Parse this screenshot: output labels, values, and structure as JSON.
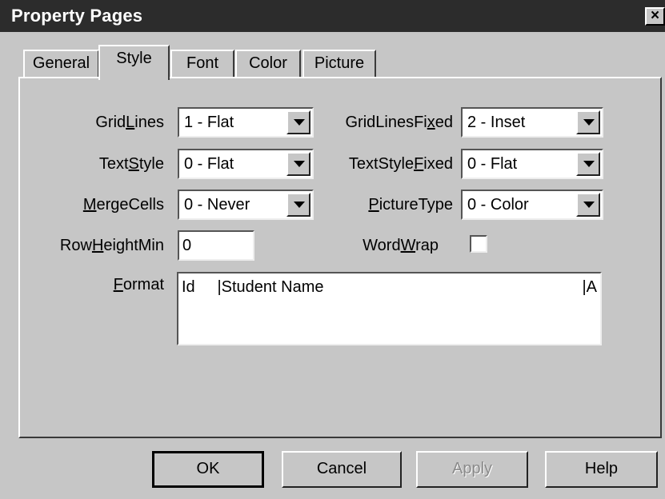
{
  "window": {
    "title": "Property Pages",
    "close_glyph": "×"
  },
  "tabs": [
    {
      "label": "General",
      "active": false
    },
    {
      "label": "Style",
      "active": true
    },
    {
      "label": "Font",
      "active": false
    },
    {
      "label": "Color",
      "active": false
    },
    {
      "label": "Picture",
      "active": false
    }
  ],
  "fields": {
    "gridlines": {
      "label_pre": "Grid",
      "label_ul": "L",
      "label_post": "ines",
      "value": "1 - Flat"
    },
    "gridlines_fixed": {
      "label_pre": "GridLinesFi",
      "label_ul": "x",
      "label_post": "ed",
      "value": "2 - Inset"
    },
    "textstyle": {
      "label_pre": "Text",
      "label_ul": "S",
      "label_post": "tyle",
      "value": "0 - Flat"
    },
    "textstyle_fixed": {
      "label_pre": "TextStyle",
      "label_ul": "F",
      "label_post": "ixed",
      "value": "0 - Flat"
    },
    "mergecells": {
      "label_pre": "",
      "label_ul": "M",
      "label_post": "ergeCells",
      "value": "0 - Never"
    },
    "picturetype": {
      "label_pre": "",
      "label_ul": "P",
      "label_post": "ictureType",
      "value": "0 - Color"
    },
    "rowheightmin": {
      "label_pre": "Row",
      "label_ul": "H",
      "label_post": "eightMin",
      "value": "0"
    },
    "wordwrap": {
      "label_pre": "Word",
      "label_ul": "W",
      "label_post": "rap",
      "checked": false
    },
    "format": {
      "label_pre": "",
      "label_ul": "F",
      "label_post": "ormat",
      "value": "Id     |Student Name",
      "value_end": "|A"
    }
  },
  "buttons": {
    "ok": "OK",
    "cancel": "Cancel",
    "apply": "Apply",
    "help": "Help"
  }
}
